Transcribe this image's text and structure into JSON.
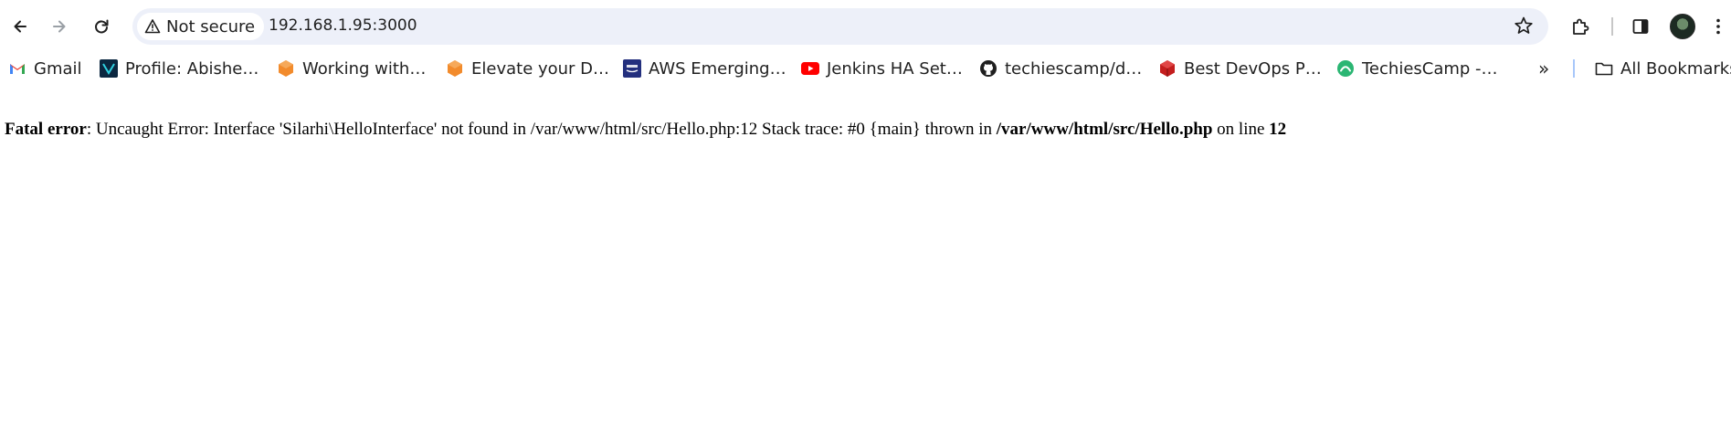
{
  "toolbar": {
    "security_label": "Not secure",
    "url": "192.168.1.95:3000",
    "icons": {
      "back": "arrow-left-icon",
      "forward": "arrow-right-icon",
      "reload": "reload-icon",
      "warning": "warning-triangle-icon",
      "bookmark_star": "star-icon",
      "extensions": "puzzle-icon",
      "side_panel": "side-panel-icon",
      "menu": "kebab-menu-icon"
    }
  },
  "bookmarks": {
    "items": [
      {
        "label": "Gmail",
        "icon": "gmail-icon",
        "color": "#ea4335"
      },
      {
        "label": "Profile: Abishe…",
        "icon": "profile-logo-icon",
        "color": "#0b2740"
      },
      {
        "label": "Working with…",
        "icon": "orange-cube-icon",
        "color": "#f28b2c"
      },
      {
        "label": "Elevate your D…",
        "icon": "orange-cube-icon",
        "color": "#f28b2c"
      },
      {
        "label": "AWS Emerging…",
        "icon": "aws-icon",
        "color": "#232f7e"
      },
      {
        "label": "Jenkins HA Set…",
        "icon": "youtube-icon",
        "color": "#ff0000"
      },
      {
        "label": "techiescamp/d…",
        "icon": "github-icon",
        "color": "#1f1f1f"
      },
      {
        "label": "Best DevOps P…",
        "icon": "red-cube-icon",
        "color": "#c41e1e"
      },
      {
        "label": "TechiesCamp -…",
        "icon": "techiescamp-icon",
        "color": "#2bb673"
      }
    ],
    "overflow": "»",
    "all_bookmarks_label": "All Bookmarks"
  },
  "error": {
    "label": "Fatal error",
    "message": ": Uncaught Error: Interface 'Silarhi\\HelloInterface' not found in /var/www/html/src/Hello.php:12 Stack trace: #0 {main} thrown in ",
    "file": "/var/www/html/src/Hello.php",
    "on_line_text": " on line ",
    "line": "12"
  }
}
